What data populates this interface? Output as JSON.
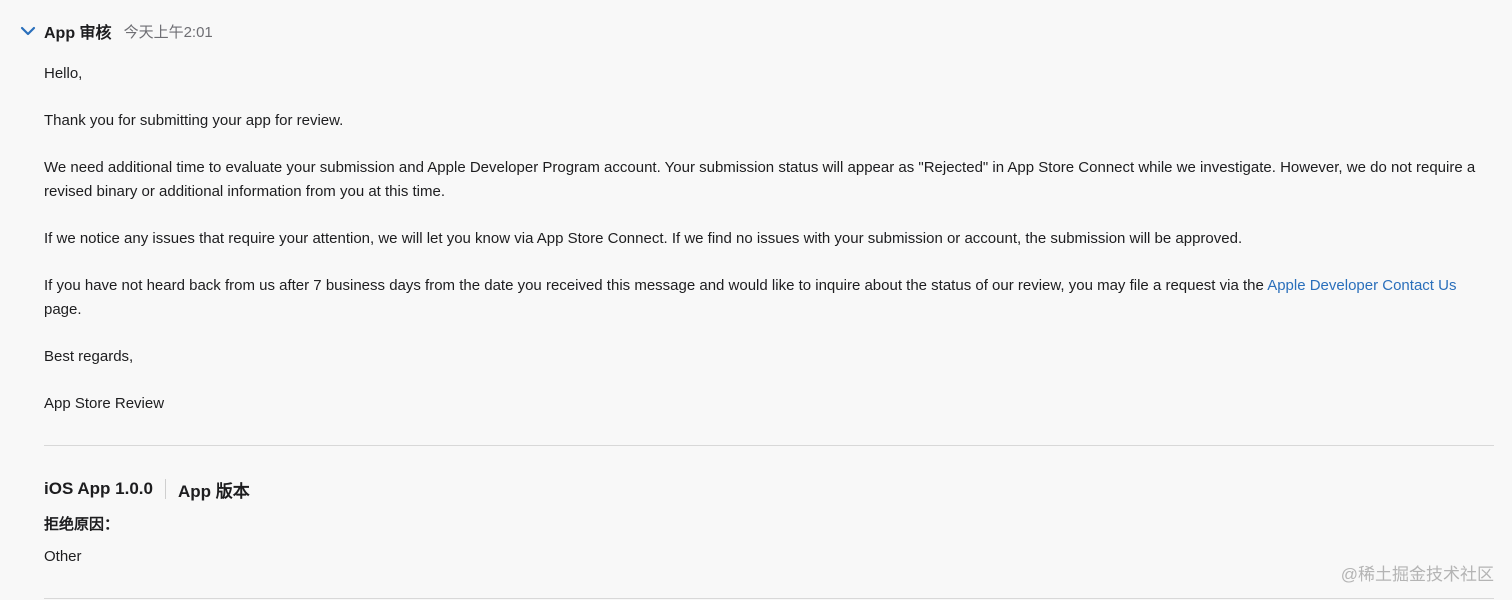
{
  "header": {
    "sender": "App 审核",
    "timestamp": "今天上午2:01"
  },
  "message": {
    "greeting": "Hello,",
    "p1": "Thank you for submitting your app for review.",
    "p2": "We need additional time to evaluate your submission and Apple Developer Program account. Your submission status will appear as \"Rejected\" in App Store Connect while we investigate. However, we do not require a revised binary or additional information from you at this time.",
    "p3": "If we notice any issues that require your attention, we will let you know via App Store Connect. If we find no issues with your submission or account, the submission will be approved.",
    "p4_before_link": "If you have not heard back from us after 7 business days from the date you received this message and would like to inquire about the status of our review, you may file a request via the ",
    "p4_link": "Apple Developer Contact Us",
    "p4_after_link": " page.",
    "closing": "Best regards,",
    "signature": "App Store Review"
  },
  "version": {
    "name": "iOS App 1.0.0",
    "type": "App 版本",
    "reason_label": "拒绝原因：",
    "reason_value": "Other"
  },
  "watermark": "@稀土掘金技术社区",
  "colors": {
    "background": "#f8f8f8",
    "text": "#1d1d1f",
    "link": "#2a6fbb",
    "chevron": "#2a6fbb",
    "muted": "#6e6e73"
  },
  "icons": {
    "collapse": "chevron-down-icon"
  }
}
